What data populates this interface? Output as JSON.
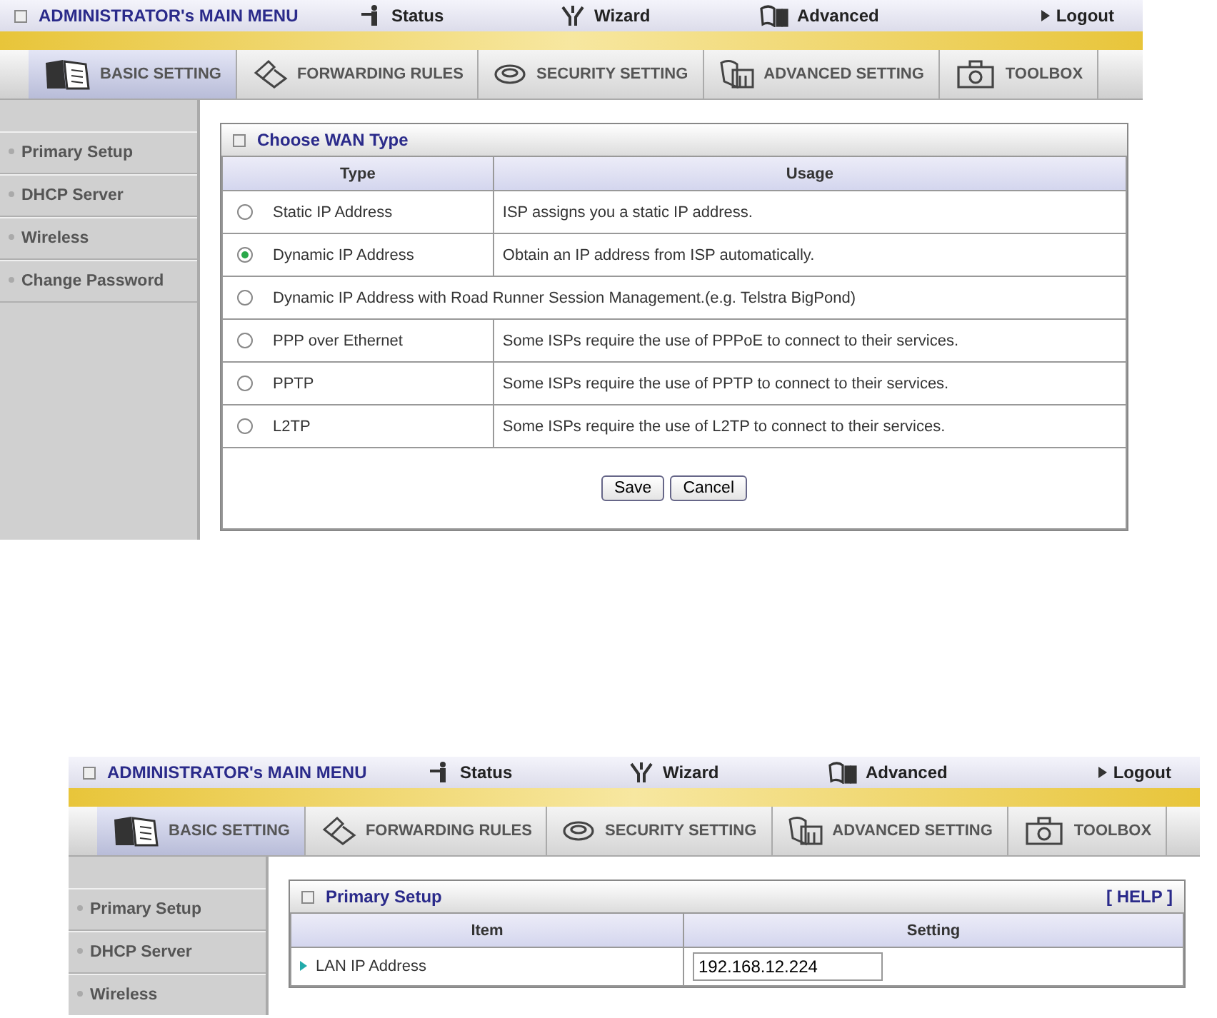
{
  "screens": [
    {
      "menu": {
        "title": "ADMINISTRATOR's MAIN MENU",
        "links": [
          {
            "label": "Status",
            "kind": "status"
          },
          {
            "label": "Wizard",
            "kind": "wizard"
          },
          {
            "label": "Advanced",
            "kind": "advanced"
          },
          {
            "label": "Logout",
            "kind": "logout"
          }
        ]
      },
      "tabs": [
        {
          "label": "BASIC SETTING",
          "kind": "basic",
          "selected": true
        },
        {
          "label": "FORWARDING RULES",
          "kind": "forwarding",
          "selected": false
        },
        {
          "label": "SECURITY SETTING",
          "kind": "security",
          "selected": false
        },
        {
          "label": "ADVANCED SETTING",
          "kind": "advanced",
          "selected": false
        },
        {
          "label": "TOOLBOX",
          "kind": "toolbox",
          "selected": false
        }
      ],
      "sidebar": {
        "items": [
          {
            "label": "Primary Setup"
          },
          {
            "label": "DHCP Server"
          },
          {
            "label": "Wireless"
          },
          {
            "label": "Change Password"
          }
        ]
      },
      "panel": {
        "kind": "wan",
        "title": "Choose WAN Type",
        "columns": [
          "Type",
          "Usage"
        ],
        "rows": [
          {
            "type": "Static IP Address",
            "usage": "ISP assigns you a static IP address.",
            "selected": false
          },
          {
            "type": "Dynamic IP Address",
            "usage": "Obtain an IP address from ISP automatically.",
            "selected": true
          },
          {
            "type": "Dynamic IP Address with Road Runner Session Management.(e.g. Telstra BigPond)",
            "selected": false
          },
          {
            "type": "PPP over Ethernet",
            "usage": "Some ISPs require the use of PPPoE to connect to their services.",
            "selected": false
          },
          {
            "type": "PPTP",
            "usage": "Some ISPs require the use of PPTP to connect to their services.",
            "selected": false
          },
          {
            "type": "L2TP",
            "usage": "Some ISPs require the use of L2TP to connect to their services.",
            "selected": false
          }
        ],
        "buttons": [
          "Save",
          "Cancel"
        ]
      }
    },
    {
      "menu": {
        "title": "ADMINISTRATOR's MAIN MENU",
        "links": [
          {
            "label": "Status",
            "kind": "status"
          },
          {
            "label": "Wizard",
            "kind": "wizard"
          },
          {
            "label": "Advanced",
            "kind": "advanced"
          },
          {
            "label": "Logout",
            "kind": "logout"
          }
        ]
      },
      "tabs": [
        {
          "label": "BASIC SETTING",
          "kind": "basic",
          "selected": true
        },
        {
          "label": "FORWARDING RULES",
          "kind": "forwarding",
          "selected": false
        },
        {
          "label": "SECURITY SETTING",
          "kind": "security",
          "selected": false
        },
        {
          "label": "ADVANCED SETTING",
          "kind": "advanced",
          "selected": false
        },
        {
          "label": "TOOLBOX",
          "kind": "toolbox",
          "selected": false
        }
      ],
      "sidebar": {
        "items": [
          {
            "label": "Primary Setup"
          },
          {
            "label": "DHCP Server"
          },
          {
            "label": "Wireless"
          }
        ]
      },
      "panel": {
        "kind": "setup",
        "title": "Primary Setup",
        "help": "[ HELP ]",
        "columns": [
          "Item",
          "Setting"
        ],
        "rows": [
          {
            "label": "LAN IP Address",
            "value": "192.168.12.224"
          }
        ]
      }
    }
  ]
}
